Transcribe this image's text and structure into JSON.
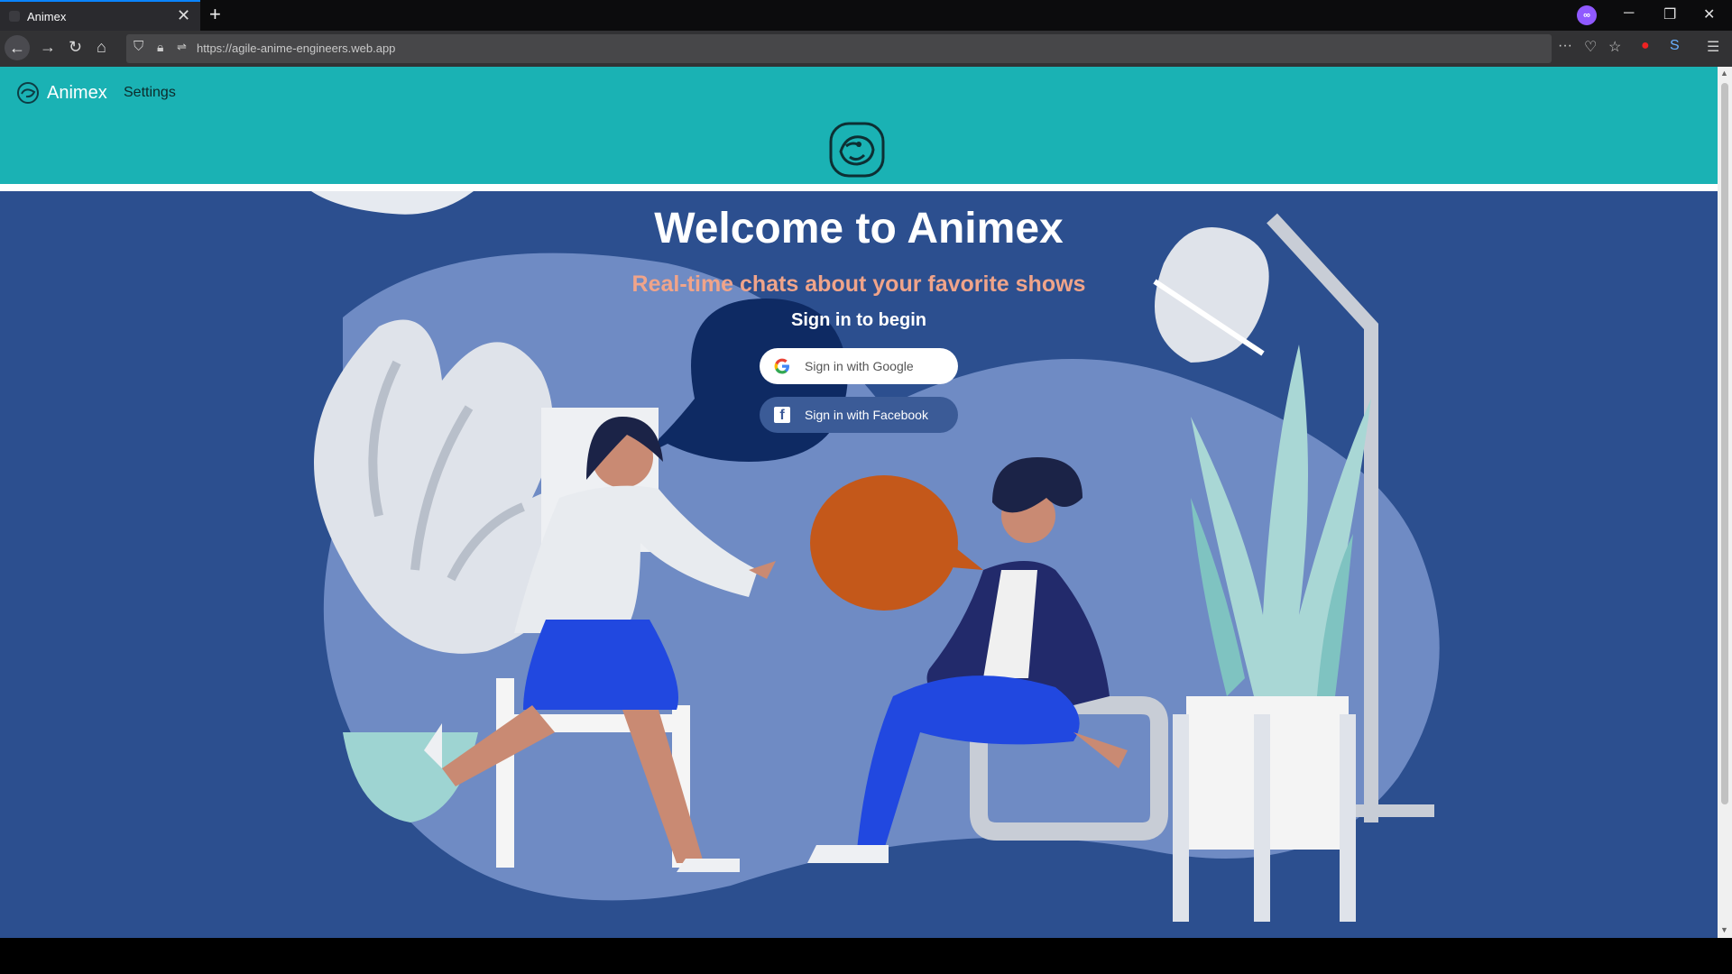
{
  "browser": {
    "tab_title": "Animex",
    "tab_close": "✕",
    "new_tab": "+",
    "url": "https://agile-anime-engineers.web.app",
    "win_min": "─",
    "win_restore": "❐",
    "win_close": "✕",
    "ext_label": "∞"
  },
  "app": {
    "brand": "Animex",
    "settings_label": "Settings"
  },
  "hero": {
    "title": "Welcome to Animex",
    "subtitle": "Real-time chats about your favorite shows",
    "prompt": "Sign in to begin"
  },
  "auth": {
    "google_label": "Sign in with Google",
    "facebook_label": "Sign in with Facebook",
    "facebook_icon_glyph": "f"
  },
  "colors": {
    "teal": "#1ab2b4",
    "background": "#2c4f8f",
    "accent_subtitle": "#f0a48a",
    "speech_orange": "#c4581a",
    "speech_navy": "#0e2a63"
  },
  "icons": [
    "back-icon",
    "forward-icon",
    "reload-icon",
    "home-icon",
    "shield-icon",
    "lock-icon",
    "menu-icon",
    "star-icon",
    "pocket-icon",
    "google-icon",
    "facebook-icon"
  ]
}
